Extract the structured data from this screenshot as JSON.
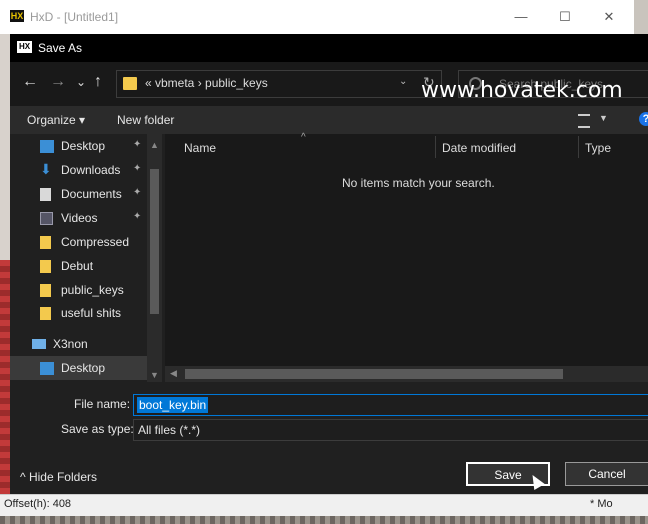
{
  "hxd": {
    "title": "HxD - [Untitled1]",
    "minimize": "—",
    "maximize": "☐",
    "close": "✕",
    "status_offset": "Offset(h): 408",
    "status_mode": "* Mo"
  },
  "dialog": {
    "title": "Save As",
    "nav": {
      "back": "←",
      "forward": "→",
      "recent": "⌄",
      "up": "↑"
    },
    "address": {
      "text": "«  vbmeta  ›  public_keys",
      "chevron": "⌄",
      "refresh": "↻"
    },
    "search": {
      "placeholder": "Search public_keys"
    },
    "watermark": "www.hovatek.com",
    "toolbar": {
      "organize": "Organize ▾",
      "new_folder": "New folder",
      "help": "?"
    },
    "nav_pane": {
      "items": [
        {
          "label": "Desktop",
          "icon": "desktop-icon",
          "pinned": true
        },
        {
          "label": "Downloads",
          "icon": "downloads-icon",
          "pinned": true
        },
        {
          "label": "Documents",
          "icon": "documents-icon",
          "pinned": true
        },
        {
          "label": "Videos",
          "icon": "videos-icon",
          "pinned": true
        },
        {
          "label": "Compressed",
          "icon": "folder-icon",
          "pinned": false
        },
        {
          "label": "Debut",
          "icon": "folder-icon",
          "pinned": false
        },
        {
          "label": "public_keys",
          "icon": "folder-icon",
          "pinned": false
        },
        {
          "label": "useful shits",
          "icon": "folder-icon",
          "pinned": false
        },
        {
          "label": "X3non",
          "icon": "computer-icon",
          "pinned": false
        },
        {
          "label": "Desktop",
          "icon": "desktop-icon",
          "pinned": false
        }
      ],
      "pin_glyph": "📌"
    },
    "columns": {
      "name": "Name",
      "date_modified": "Date modified",
      "type": "Type"
    },
    "empty_message": "No items match your search.",
    "file_name_label": "File name:",
    "file_name_value": "boot_key.bin",
    "save_as_type_label": "Save as type:",
    "save_as_type_value": "All files (*.*)",
    "hide_folders": "^  Hide Folders",
    "save_button": "Save",
    "cancel_button": "Cancel"
  },
  "colors": {
    "accent": "#0078d7",
    "folder": "#f3c94d",
    "dialog_bg": "#202020"
  }
}
